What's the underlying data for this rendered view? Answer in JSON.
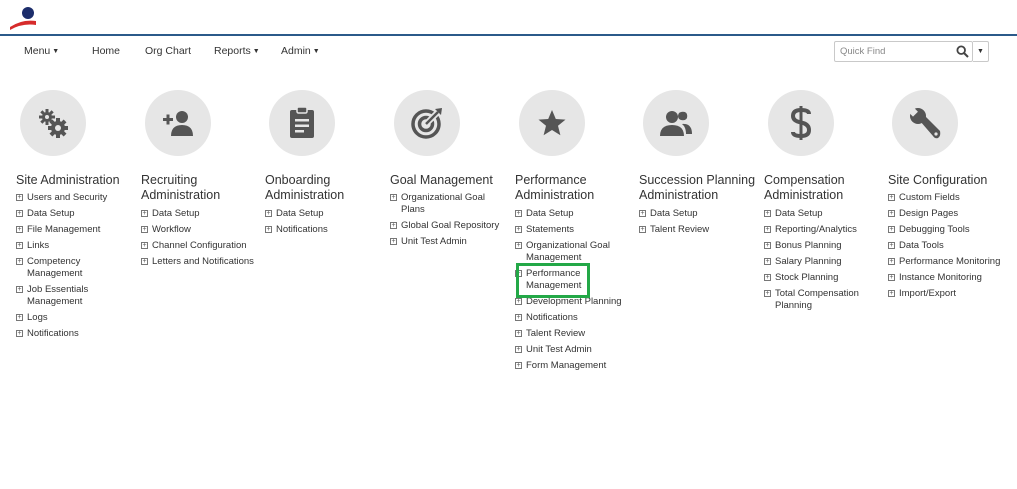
{
  "nav": {
    "menu": "Menu",
    "home": "Home",
    "org_chart": "Org Chart",
    "reports": "Reports",
    "admin": "Admin"
  },
  "search": {
    "placeholder": "Quick Find"
  },
  "tiles": [
    {
      "title": "Site Administration",
      "icon": "gears-icon",
      "links": [
        "Users and Security",
        "Data Setup",
        "File Management",
        "Links",
        "Competency Management",
        "Job Essentials Management",
        "Logs",
        "Notifications"
      ]
    },
    {
      "title": "Recruiting Administration",
      "icon": "add-person-icon",
      "links": [
        "Data Setup",
        "Workflow",
        "Channel Configuration",
        "Letters and Notifications"
      ]
    },
    {
      "title": "Onboarding Administration",
      "icon": "clipboard-icon",
      "links": [
        "Data Setup",
        "Notifications"
      ]
    },
    {
      "title": "Goal Management",
      "icon": "target-icon",
      "links": [
        "Organizational Goal Plans",
        "Global Goal Repository",
        "Unit Test Admin"
      ]
    },
    {
      "title": "Performance Administration",
      "icon": "star-icon",
      "links": [
        "Data Setup",
        "Statements",
        "Organizational Goal Management",
        "Performance Management",
        "Development Planning",
        "Notifications",
        "Talent Review",
        "Unit Test Admin",
        "Form Management"
      ]
    },
    {
      "title": "Succession Planning Administration",
      "icon": "people-icon",
      "links": [
        "Data Setup",
        "Talent Review"
      ]
    },
    {
      "title": "Compensation Administration",
      "icon": "dollar-icon",
      "links": [
        "Data Setup",
        "Reporting/Analytics",
        "Bonus Planning",
        "Salary Planning",
        "Stock Planning",
        "Total Compensation Planning"
      ]
    },
    {
      "title": "Site Configuration",
      "icon": "wrench-icon",
      "links": [
        "Custom Fields",
        "Design Pages",
        "Debugging Tools",
        "Data Tools",
        "Performance Monitoring",
        "Instance Monitoring",
        "Import/Export"
      ]
    }
  ],
  "colors": {
    "accent_line": "#2b5a8a",
    "highlight": "#23a847",
    "circle": "#e6e6e6",
    "icon": "#555555"
  }
}
